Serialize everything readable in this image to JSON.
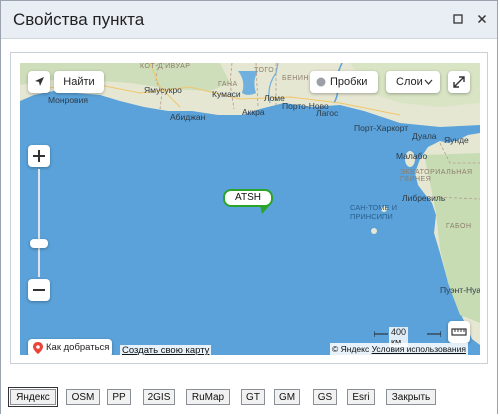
{
  "dialog": {
    "title": "Свойства пункта",
    "minimize_icon": "window-icon",
    "close_icon": "close-icon"
  },
  "map": {
    "find_label": "Найти",
    "traffic_label": "Пробки",
    "layers_label": "Слои",
    "route_label": "Как добраться",
    "create_map_label": "Создать свою карту",
    "scale_label": "400 км",
    "copyright": "© Яндекс",
    "terms_link": "Условия использования",
    "marker_label": "ATSH",
    "places": {
      "kot_divuar": "КОТ-Д'ИВУАР",
      "gana": "ГАНА",
      "togo": "ТОГО",
      "benin": "БЕНИН",
      "monrovia": "Монровия",
      "yamusukro": "Ямусукро",
      "kumasi": "Кумаси",
      "abidzhan": "Абиджан",
      "lome": "Ломе",
      "porto_novo": "Порто-Ново",
      "akkra": "Аккра",
      "lagos": "Лагос",
      "port_harkort": "Порт-Харкорт",
      "duala": "Дуала",
      "yaunde": "Яунде",
      "malabo": "Малабо",
      "eq_guinea": "ЭКВАТОРИАЛЬНАЯ ГВИНЕЯ",
      "librevil": "Либревиль",
      "sao_tome": "САН-ТОМЕ И ПРИНСИПИ",
      "gabon": "ГАБОН",
      "puent_noir": "Пуэнт-Нуар"
    }
  },
  "footer": {
    "buttons": [
      "Яндекс",
      "OSM",
      "РР",
      "2GIS",
      "RuMap",
      "GT",
      "GM",
      "GS",
      "Esri",
      "Закрыть"
    ],
    "active": "Яндекс"
  },
  "colors": {
    "water": "#5aa2d9",
    "land": "#e6e7d2",
    "forest": "#c8dcb4",
    "marker": "#2aa52a"
  }
}
